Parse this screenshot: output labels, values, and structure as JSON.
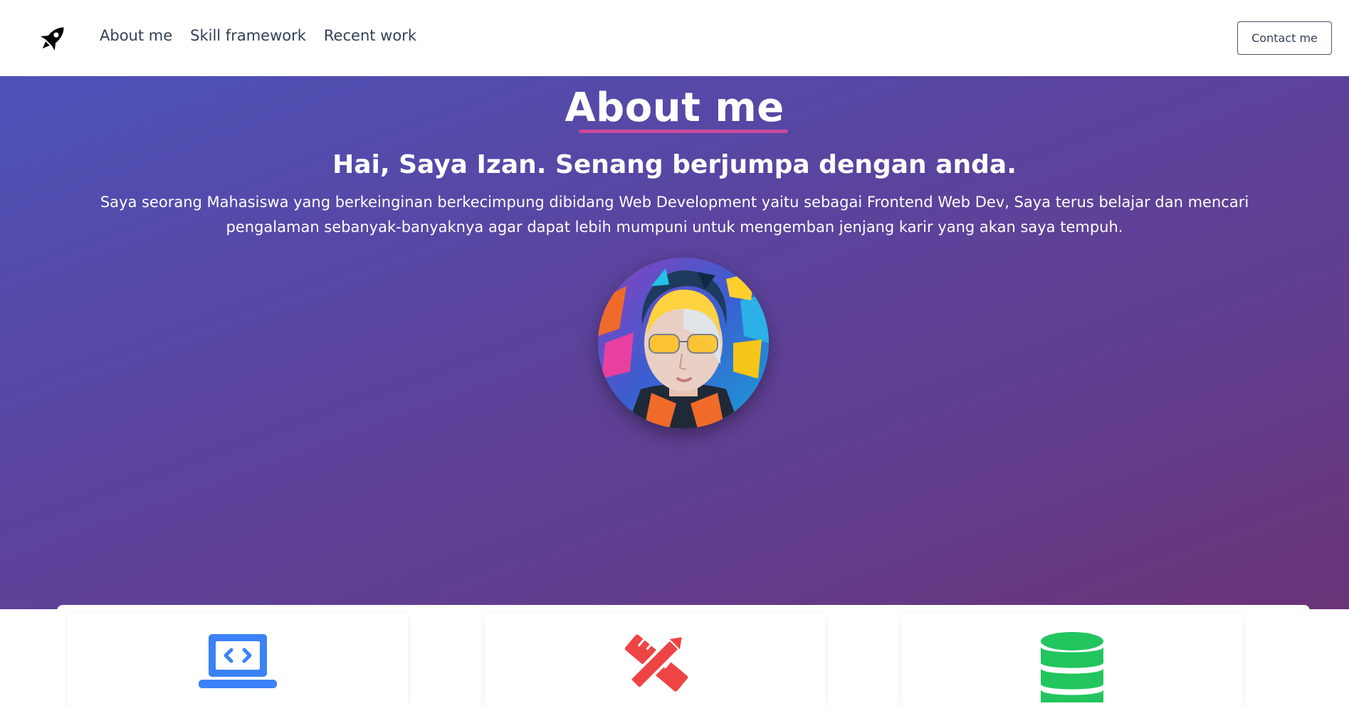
{
  "nav": {
    "logo_icon": "rocket-icon",
    "links": [
      {
        "label": "About me"
      },
      {
        "label": "Skill framework"
      },
      {
        "label": "Recent work"
      }
    ],
    "contact_label": "Contact me"
  },
  "hero": {
    "title": "About me",
    "subtitle": "Hai, Saya Izan. Senang berjumpa dengan anda.",
    "description": "Saya seorang Mahasiswa yang berkeinginan berkecimpung dibidang Web Development yaitu sebagai Frontend Web Dev, Saya terus belajar dan mencari pengalaman sebanyak-banyaknya agar dapat lebih mumpuni untuk mengemban jenjang karir yang akan saya tempuh.",
    "accent_underline_color": "#c84aa0"
  },
  "skills": [
    {
      "icon": "code-laptop-icon",
      "color": "#3b82f6"
    },
    {
      "icon": "pencil-ruler-icon",
      "color": "#ef4444"
    },
    {
      "icon": "database-icon",
      "color": "#22c55e"
    }
  ]
}
